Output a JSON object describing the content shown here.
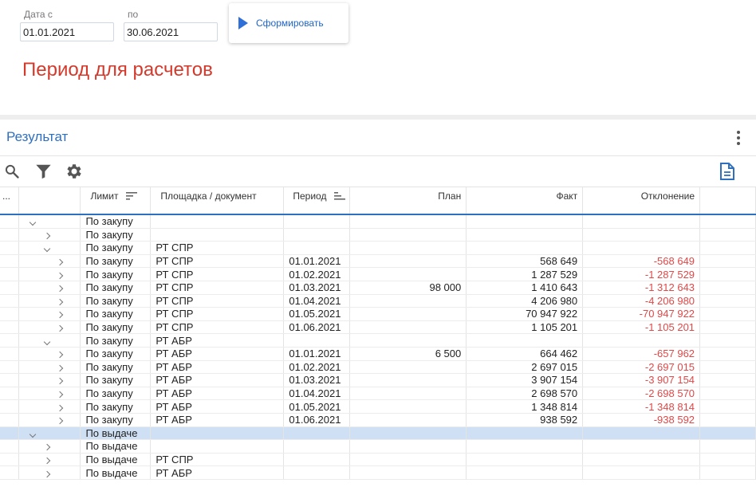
{
  "filters": {
    "date_from_label": "Дата с",
    "date_from": "01.01.2021",
    "date_to_label": "по",
    "date_to": "30.06.2021",
    "submit_label": "Сформировать"
  },
  "period_title": "Период для расчетов",
  "result": {
    "title": "Результат",
    "columns": {
      "more": "...",
      "limit": "Лимит",
      "site": "Площадка / документ",
      "period": "Период",
      "plan": "План",
      "fact": "Факт",
      "deviation": "Отклонение"
    },
    "rows": [
      {
        "level": 1,
        "expanded": true,
        "limit": "По закупу",
        "site": "",
        "period": "",
        "plan": "",
        "fact": "",
        "dev": ""
      },
      {
        "level": 2,
        "expanded": false,
        "limit": "По закупу",
        "site": "",
        "period": "",
        "plan": "",
        "fact": "",
        "dev": ""
      },
      {
        "level": 2,
        "expanded": true,
        "limit": "По закупу",
        "site": "РТ СПР",
        "period": "",
        "plan": "",
        "fact": "",
        "dev": ""
      },
      {
        "level": 3,
        "expanded": false,
        "limit": "По закупу",
        "site": "РТ СПР",
        "period": "01.01.2021",
        "plan": "",
        "fact": "568 649",
        "dev": "-568 649"
      },
      {
        "level": 3,
        "expanded": false,
        "limit": "По закупу",
        "site": "РТ СПР",
        "period": "01.02.2021",
        "plan": "",
        "fact": "1 287 529",
        "dev": "-1 287 529"
      },
      {
        "level": 3,
        "expanded": false,
        "limit": "По закупу",
        "site": "РТ СПР",
        "period": "01.03.2021",
        "plan": "98 000",
        "fact": "1 410 643",
        "dev": "-1 312 643"
      },
      {
        "level": 3,
        "expanded": false,
        "limit": "По закупу",
        "site": "РТ СПР",
        "period": "01.04.2021",
        "plan": "",
        "fact": "4 206 980",
        "dev": "-4 206 980"
      },
      {
        "level": 3,
        "expanded": false,
        "limit": "По закупу",
        "site": "РТ СПР",
        "period": "01.05.2021",
        "plan": "",
        "fact": "70 947 922",
        "dev": "-70 947 922"
      },
      {
        "level": 3,
        "expanded": false,
        "limit": "По закупу",
        "site": "РТ СПР",
        "period": "01.06.2021",
        "plan": "",
        "fact": "1 105 201",
        "dev": "-1 105 201"
      },
      {
        "level": 2,
        "expanded": true,
        "limit": "По закупу",
        "site": "РТ АБР",
        "period": "",
        "plan": "",
        "fact": "",
        "dev": ""
      },
      {
        "level": 3,
        "expanded": false,
        "limit": "По закупу",
        "site": "РТ АБР",
        "period": "01.01.2021",
        "plan": "6 500",
        "fact": "664 462",
        "dev": "-657 962"
      },
      {
        "level": 3,
        "expanded": false,
        "limit": "По закупу",
        "site": "РТ АБР",
        "period": "01.02.2021",
        "plan": "",
        "fact": "2 697 015",
        "dev": "-2 697 015"
      },
      {
        "level": 3,
        "expanded": false,
        "limit": "По закупу",
        "site": "РТ АБР",
        "period": "01.03.2021",
        "plan": "",
        "fact": "3 907 154",
        "dev": "-3 907 154"
      },
      {
        "level": 3,
        "expanded": false,
        "limit": "По закупу",
        "site": "РТ АБР",
        "period": "01.04.2021",
        "plan": "",
        "fact": "2 698 570",
        "dev": "-2 698 570"
      },
      {
        "level": 3,
        "expanded": false,
        "limit": "По закупу",
        "site": "РТ АБР",
        "period": "01.05.2021",
        "plan": "",
        "fact": "1 348 814",
        "dev": "-1 348 814"
      },
      {
        "level": 3,
        "expanded": false,
        "limit": "По закупу",
        "site": "РТ АБР",
        "period": "01.06.2021",
        "plan": "",
        "fact": "938 592",
        "dev": "-938 592"
      },
      {
        "level": 1,
        "expanded": true,
        "selected": true,
        "limit": "По выдаче",
        "site": "",
        "period": "",
        "plan": "",
        "fact": "",
        "dev": ""
      },
      {
        "level": 2,
        "expanded": false,
        "limit": "По выдаче",
        "site": "",
        "period": "",
        "plan": "",
        "fact": "",
        "dev": ""
      },
      {
        "level": 2,
        "expanded": false,
        "limit": "По выдаче",
        "site": "РТ СПР",
        "period": "",
        "plan": "",
        "fact": "",
        "dev": ""
      },
      {
        "level": 2,
        "expanded": false,
        "limit": "По выдаче",
        "site": "РТ АБР",
        "period": "",
        "plan": "",
        "fact": "",
        "dev": ""
      }
    ]
  },
  "icons": {
    "search": "search-icon",
    "filter": "filter-icon",
    "settings": "gear-icon",
    "export": "document-icon",
    "menu": "more-vertical-icon"
  },
  "colors": {
    "accent": "#2f6fc0",
    "negative": "#e04848",
    "period_title": "#d33a2c",
    "selected_row": "#cfe0f4"
  }
}
